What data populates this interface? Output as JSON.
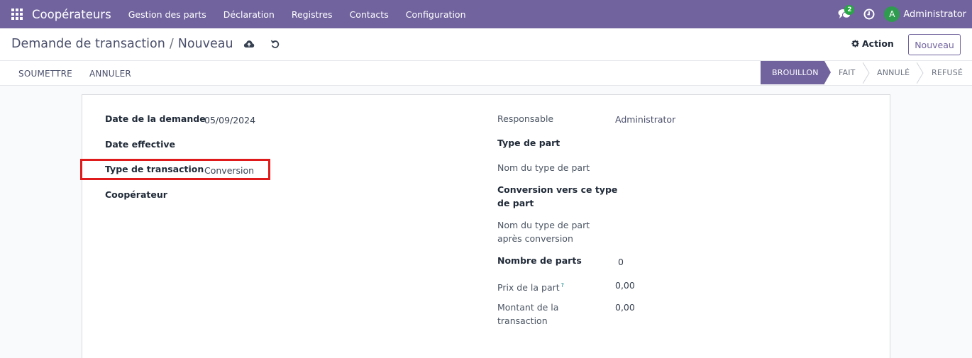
{
  "navbar": {
    "app_title": "Coopérateurs",
    "menu": [
      {
        "label": "Gestion des parts"
      },
      {
        "label": "Déclaration"
      },
      {
        "label": "Registres"
      },
      {
        "label": "Contacts"
      },
      {
        "label": "Configuration"
      }
    ],
    "chat_badge": "2",
    "user_initial": "A",
    "user_name": "Administrator"
  },
  "control": {
    "breadcrumb_parent": "Demande de transaction",
    "breadcrumb_separator": "/",
    "breadcrumb_current": "Nouveau",
    "action_label": "Action",
    "new_label": "Nouveau"
  },
  "statusbar": {
    "submit_label": "SOUMETTRE",
    "cancel_label": "ANNULER",
    "stages": [
      {
        "label": "BROUILLON",
        "active": true
      },
      {
        "label": "FAIT",
        "active": false
      },
      {
        "label": "ANNULÉ",
        "active": false
      },
      {
        "label": "REFUSÉ",
        "active": false
      }
    ]
  },
  "form": {
    "left": {
      "date_demande_label": "Date de la demande",
      "date_demande_value": "05/09/2024",
      "date_effective_label": "Date effective",
      "type_transaction_label": "Type de transaction",
      "type_transaction_value": "Conversion",
      "cooperateur_label": "Coopérateur"
    },
    "right": {
      "responsable_label": "Responsable",
      "responsable_value": "Administrator",
      "type_part_label": "Type de part",
      "nom_type_part_label": "Nom du type de part",
      "conversion_label_1": "Conversion vers ce type",
      "conversion_label_2": "de part",
      "nom_apres_label_1": "Nom du type de part",
      "nom_apres_label_2": "après conversion",
      "nombre_parts_label": "Nombre de parts",
      "nombre_parts_value": "0",
      "prix_part_label": "Prix de la part",
      "prix_part_help": "?",
      "prix_part_value": "0,00",
      "montant_label_1": "Montant de la",
      "montant_label_2": "transaction",
      "montant_value": "0,00"
    }
  },
  "colors": {
    "brand": "#71639e",
    "highlight": "#e01b1b",
    "badge": "#28a745"
  }
}
